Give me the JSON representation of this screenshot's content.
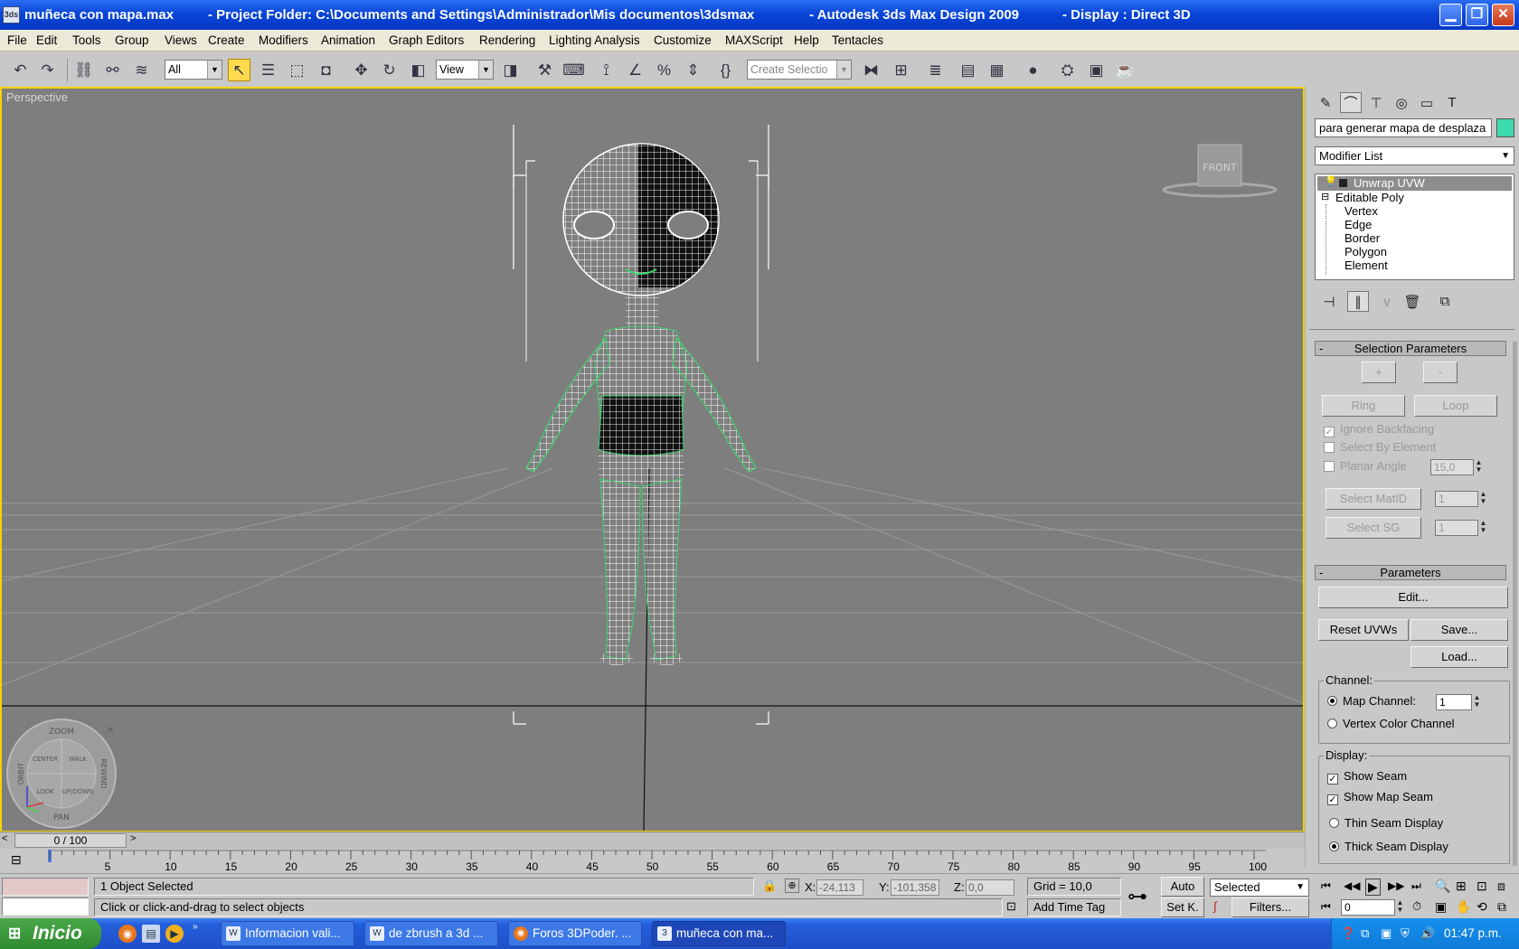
{
  "window": {
    "file": "muñeca con mapa.max",
    "project_folder": "- Project Folder: C:\\Documents and Settings\\Administrador\\Mis documentos\\3dsmax",
    "app": "- Autodesk 3ds Max Design 2009",
    "display": "- Display : Direct 3D"
  },
  "menu": [
    "File",
    "Edit",
    "Tools",
    "Group",
    "Views",
    "Create",
    "Modifiers",
    "Animation",
    "Graph Editors",
    "Rendering",
    "Lighting Analysis",
    "Customize",
    "MAXScript",
    "Help",
    "Tentacles"
  ],
  "toolbar": {
    "selection_filter": "All",
    "reference_coord": "View",
    "named_selection": "Create Selectio"
  },
  "viewport": {
    "label": "Perspective",
    "viewcube_face": "FRONT",
    "steering_wheel": {
      "top": "ZOOM",
      "bottom": "PAN",
      "left": "ORBIT",
      "right": "REWIND",
      "center": "CENTER",
      "walk": "WALK",
      "look": "LOOK",
      "up_down": "UP/DOWN"
    }
  },
  "command_panel": {
    "object_name": "para generar mapa de desplaza",
    "object_color": "#3fd9b0",
    "modifier_list": "Modifier List",
    "stack": {
      "top": "Unwrap UVW",
      "base": "Editable Poly",
      "subobjects": [
        "Vertex",
        "Edge",
        "Border",
        "Polygon",
        "Element"
      ]
    },
    "selection_parameters": {
      "title": "Selection Parameters",
      "plus": "+",
      "minus": "-",
      "ring": "Ring",
      "loop": "Loop",
      "ignore_backfacing": "Ignore Backfacing",
      "select_by_element": "Select By Element",
      "planar_angle": "Planar Angle",
      "planar_angle_value": "15,0",
      "select_matid": "Select MatID",
      "matid_value": "1",
      "select_sg": "Select SG",
      "sg_value": "1"
    },
    "parameters": {
      "title": "Parameters",
      "edit": "Edit...",
      "reset_uvws": "Reset UVWs",
      "save": "Save...",
      "load": "Load...",
      "channel_group": "Channel:",
      "map_channel": "Map Channel:",
      "map_channel_value": "1",
      "vertex_color_channel": "Vertex Color Channel",
      "display_group": "Display:",
      "show_seam": "Show Seam",
      "show_map_seam": "Show Map Seam",
      "thin_seam": "Thin Seam Display",
      "thick_seam": "Thick Seam Display"
    }
  },
  "timeline": {
    "frame_counter": "0 / 100",
    "ticks": [
      "5",
      "10",
      "15",
      "20",
      "25",
      "30",
      "35",
      "40",
      "45",
      "50",
      "55",
      "60",
      "65",
      "70",
      "75",
      "80",
      "85",
      "90",
      "95",
      "100"
    ]
  },
  "status": {
    "selected": "1 Object Selected",
    "prompt": "Click or click-and-drag to select objects",
    "x_label": "X:",
    "x_value": "-24,113",
    "y_label": "Y:",
    "y_value": "-101,358",
    "z_label": "Z:",
    "z_value": "0,0",
    "grid": "Grid = 10,0",
    "add_time_tag": "Add Time Tag",
    "auto_key": "Auto",
    "set_key": "Set K.",
    "key_filter": "Selected",
    "filters": "Filters...",
    "current_frame": "0"
  },
  "taskbar": {
    "start": "Inicio",
    "tasks": [
      "Informacion vali...",
      "de zbrush a 3d ...",
      "Foros 3DPoder. ...",
      "muñeca con ma..."
    ],
    "clock": "01:47 p.m."
  }
}
